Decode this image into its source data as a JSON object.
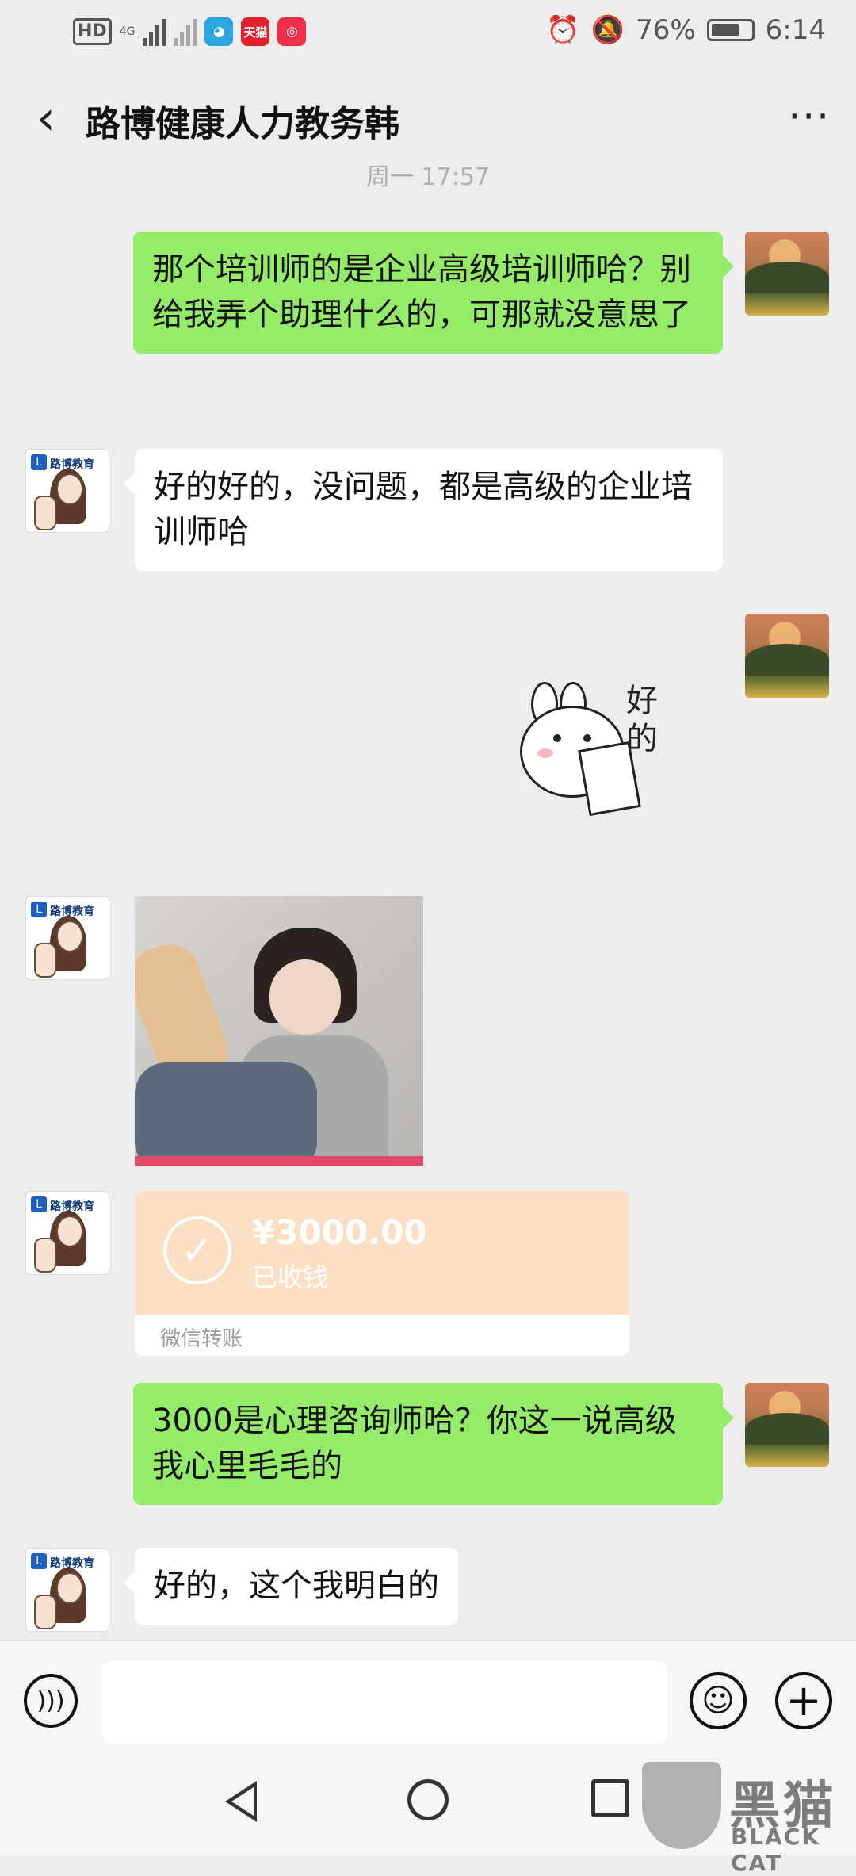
{
  "status_bar": {
    "hd": "HD",
    "net_left": "4G",
    "apps": [
      "天猫"
    ],
    "battery": "76%",
    "time": "6:14"
  },
  "header": {
    "title": "路博健康人力教务韩",
    "back_icon": "chevron-left-icon",
    "more": "···"
  },
  "chat": {
    "time_label": "周一 17:57",
    "messages": [
      {
        "from": "self",
        "text": "那个培训师的是企业高级培训师哈？别给我弄个助理什么的，可那就没意思了"
      },
      {
        "from": "other",
        "text": "好的好的，没问题，都是高级的企业培训师哈"
      },
      {
        "from": "self",
        "type": "sticker",
        "text": "好的"
      },
      {
        "from": "other",
        "type": "image"
      },
      {
        "from": "other",
        "type": "transfer",
        "amount": "¥3000.00",
        "status": "已收钱",
        "label": "微信转账"
      },
      {
        "from": "self",
        "text": "3000是心理咨询师哈？你这一说高级我心里毛毛的"
      },
      {
        "from": "other",
        "text": "好的，这个我明白的"
      }
    ],
    "other_avatar_brand": "路博教育"
  },
  "input_bar": {
    "placeholder": "",
    "voice_icon": "voice-icon",
    "emoji_icon": "emoji-icon",
    "plus_icon": "plus-icon"
  },
  "watermark": {
    "cn": "黑猫",
    "en": "BLACK CAT"
  },
  "colors": {
    "self_bubble": "#95ec69",
    "other_bubble": "#ffffff",
    "background": "#ededed",
    "transfer": "#fbdfc3"
  }
}
